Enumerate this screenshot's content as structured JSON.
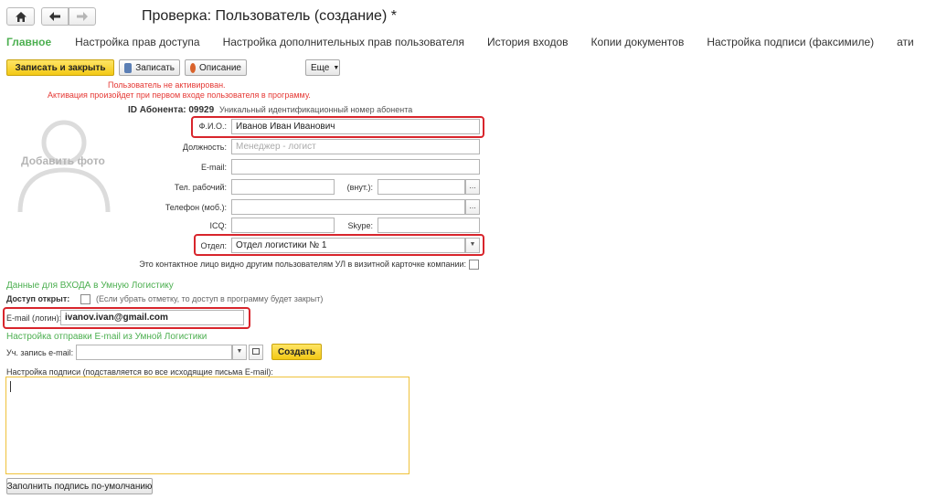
{
  "window": {
    "title": "Проверка: Пользователь (создание) *"
  },
  "tabs": [
    "Главное",
    "Настройка прав доступа",
    "Настройка дополнительных прав пользователя",
    "История входов",
    "Копии документов",
    "Настройка подписи (факсимиле)",
    "ати"
  ],
  "toolbar": {
    "save_close": "Записать и закрыть",
    "save": "Записать",
    "description": "Описание",
    "more": "Еще"
  },
  "warnings": {
    "not_active": "Пользователь не активирован.",
    "activation_note": "Активация произойдет при первом входе пользователя в программу."
  },
  "subscriber": {
    "label": "ID Абонента:",
    "value": "09929",
    "hint": "Уникальный идентификационный номер абонента"
  },
  "photo": {
    "label": "Добавить фото"
  },
  "form": {
    "fio": {
      "label": "Ф.И.О.:",
      "value": "Иванов Иван Иванович"
    },
    "position": {
      "label": "Должность:",
      "placeholder": "Менеджер - логист"
    },
    "email": {
      "label": "E-mail:",
      "value": ""
    },
    "work_phone": {
      "label": "Тел. рабочий:",
      "value": ""
    },
    "ext": {
      "label": "(внут.):",
      "value": ""
    },
    "mobile": {
      "label": "Телефон (моб.):",
      "value": ""
    },
    "icq": {
      "label": "ICQ:",
      "value": ""
    },
    "skype": {
      "label": "Skype:",
      "value": ""
    },
    "department": {
      "label": "Отдел:",
      "value": "Отдел логистики № 1"
    },
    "visible_contact": {
      "label": "Это контактное лицо видно другим пользователям УЛ в визитной карточке компании:",
      "checked": false
    },
    "dots": "..."
  },
  "login_section": {
    "title": "Данные для ВХОДА в Умную Логистику",
    "access_label": "Доступ открыт:",
    "access_note": "(Если убрать отметку, то доступ в программу будет закрыт)",
    "access_checked": false,
    "email_label": "E-mail (логин):",
    "email_value": "ivanov.ivan@gmail.com"
  },
  "mail_section": {
    "title": "Настройка отправки E-mail из Умной Логистики",
    "account_label": "Уч. запись e-mail:",
    "account_value": "",
    "create_button": "Создать",
    "signature_label": "Настройка подписи (подставляется во все исходящие письма E-mail):",
    "signature_value": "",
    "default_button": "Заполнить подпись по-умолчанию"
  }
}
